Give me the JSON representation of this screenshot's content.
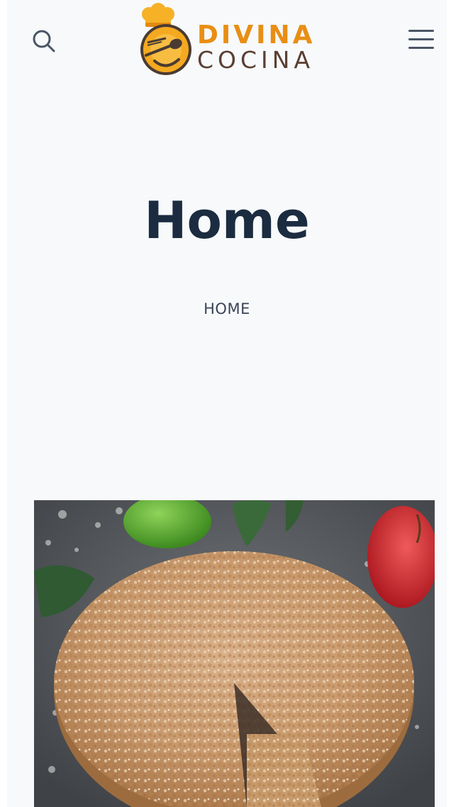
{
  "header": {
    "logo": {
      "word1": "DIVINA",
      "word2": "COCINA",
      "icon": "chef-hat-plate-icon"
    },
    "search_icon": "search-icon",
    "menu_icon": "hamburger-menu-icon"
  },
  "main": {
    "title": "Home",
    "breadcrumb": [
      "HOME"
    ]
  },
  "featured_image": {
    "subject": "apple-crumble-cake-photo"
  },
  "colors": {
    "page_bg": "#f7f9fb",
    "title": "#1b2b40",
    "breadcrumb": "#3a4556",
    "logo_orange": "#e98e14",
    "logo_brown": "#5a3f33",
    "icon": "#4a5566"
  }
}
